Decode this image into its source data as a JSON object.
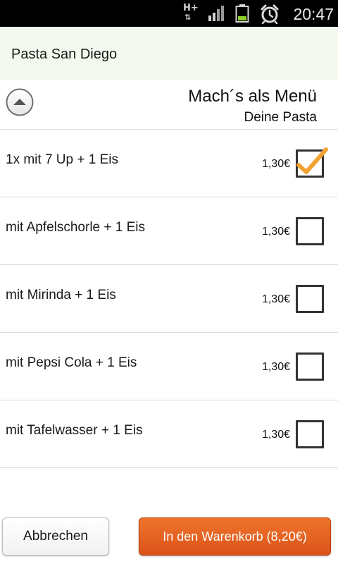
{
  "status_bar": {
    "network_label": "H+",
    "time": "20:47",
    "icons": [
      "network-hplus-icon",
      "signal-bars-icon",
      "battery-icon",
      "alarm-clock-icon"
    ]
  },
  "header": {
    "title": "Pasta San Diego",
    "background_color": "#f3f9ee"
  },
  "section": {
    "title": "Mach´s als Menü",
    "subtitle": "Deine Pasta",
    "collapse_icon": "chevron-up-circle-icon"
  },
  "options": [
    {
      "label": "1x mit 7 Up + 1 Eis",
      "price": "1,30€",
      "checked": true
    },
    {
      "label": "mit Apfelschorle + 1 Eis",
      "price": "1,30€",
      "checked": false
    },
    {
      "label": "mit Mirinda + 1 Eis",
      "price": "1,30€",
      "checked": false
    },
    {
      "label": "mit Pepsi Cola + 1 Eis",
      "price": "1,30€",
      "checked": false
    },
    {
      "label": "mit Tafelwasser + 1 Eis",
      "price": "1,30€",
      "checked": false
    }
  ],
  "actions": {
    "cancel_label": "Abbrechen",
    "cart_label": "In den Warenkorb (8,20€)"
  },
  "colors": {
    "accent_orange": "#e8621f",
    "checkmark": "#f0a233"
  }
}
